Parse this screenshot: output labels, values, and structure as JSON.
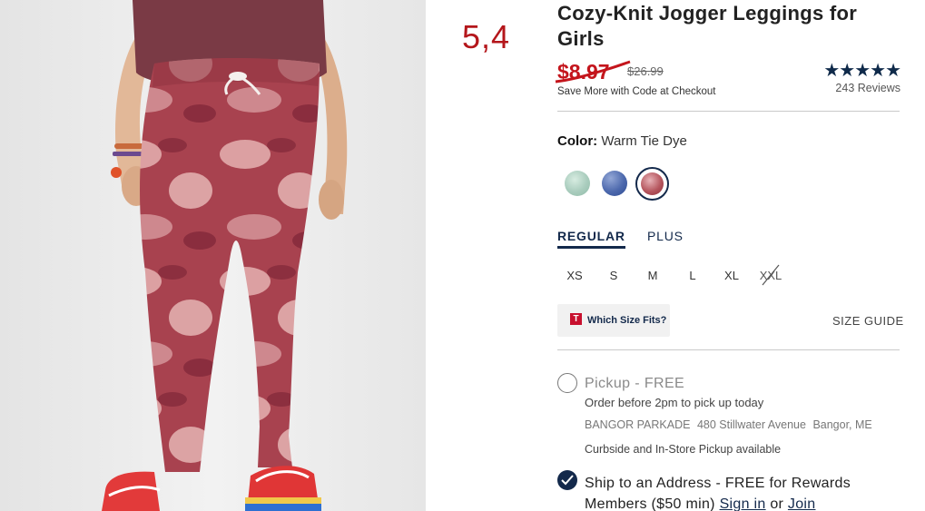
{
  "annotation": "5,4",
  "product": {
    "title": "Cozy-Knit Jogger Leggings for Girls",
    "sale_price": "$8.97",
    "original_price": "$26.99",
    "promo_note": "Save More with Code at Checkout",
    "rating_stars": "★★★★★",
    "rating_value": 5,
    "reviews": "243 Reviews"
  },
  "color": {
    "label": "Color:",
    "selected": "Warm Tie Dye",
    "swatches": [
      "mint-tie-dye",
      "blue-tie-dye",
      "warm-tie-dye"
    ]
  },
  "fit": {
    "regular": "REGULAR",
    "plus": "PLUS"
  },
  "sizes": [
    "XS",
    "S",
    "M",
    "L",
    "XL",
    "XXL"
  ],
  "size_help": {
    "badge": "T",
    "which_fits": "Which Size Fits?",
    "size_guide": "SIZE GUIDE"
  },
  "pickup": {
    "title": "Pickup - FREE",
    "subtitle": "Order before 2pm to pick up today",
    "store_name": "BANGOR PARKADE",
    "store_street": "480 Stillwater Avenue",
    "store_city": "Bangor, ME",
    "curbside": "Curbside and In-Store Pickup available"
  },
  "ship": {
    "text": "Ship to an Address - FREE for Rewards Members ($50 min)",
    "sign_in": "Sign in",
    "or": "or",
    "join": "Join"
  },
  "colors": {
    "navy": "#13294b",
    "sale_red": "#c4151c",
    "annotation_red": "#b4161b"
  }
}
